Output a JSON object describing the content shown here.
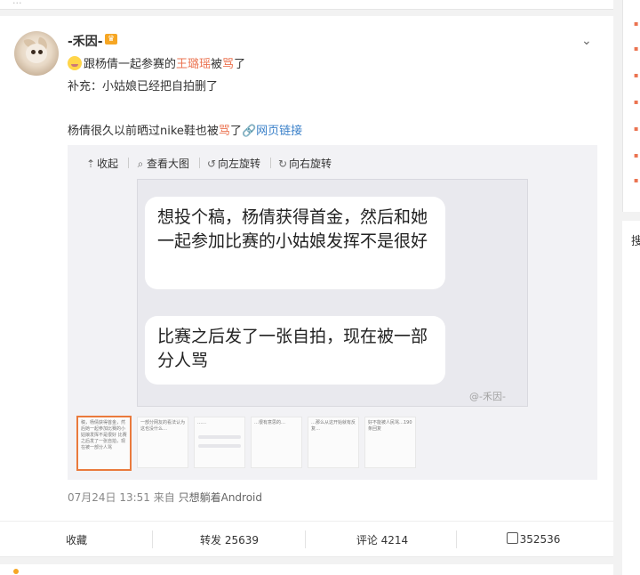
{
  "top_fragment": "...",
  "post": {
    "username": "-禾因-",
    "badge_icon": "crown-icon",
    "emoji_icon": "sleepy-face-emoji",
    "line1_prefix": "跟杨倩一起参赛的",
    "line1_highlight": "王璐瑶",
    "line1_middle": "被",
    "line1_link": "骂",
    "line1_suffix": "了",
    "line2": "补充：小姑娘已经把自拍删了",
    "line3_prefix": "杨倩很久以前晒过nike鞋也被",
    "line3_link": "骂",
    "line3_suffix": "了",
    "weblink": "网页链接"
  },
  "media_toolbar": {
    "collapse": "收起",
    "view_large": "查看大图",
    "rotate_left": "向左旋转",
    "rotate_right": "向右旋转"
  },
  "image_content": {
    "bubble1": "想投个稿，杨倩获得首金，然后和她一起参加比赛的小姑娘发挥不是很好",
    "bubble2": "比赛之后发了一张自拍，现在被一部分人骂",
    "watermark": "@-禾因-"
  },
  "thumbnails": [
    {
      "text": "稿，杨倩获得首金，然后她一起参加比赛的小姑娘发挥不是很好 比赛之后发了一张自拍，现在被一部分人骂",
      "selected": true
    },
    {
      "text": "一部分网友的看法认为这也没什么…",
      "selected": false
    },
    {
      "text": "……",
      "selected": false
    },
    {
      "text": "…很有意思的…",
      "selected": false
    },
    {
      "text": "…那么从这开始就有反复…",
      "selected": false
    },
    {
      "text": "好不能被人民骂…190条回复",
      "selected": false
    }
  ],
  "meta": {
    "date": "07月24日 13:51",
    "from_label": "来自",
    "source": "只想躺着Android"
  },
  "actions": {
    "favorite": "收藏",
    "repost": "转发 25639",
    "comment": "评论 4214",
    "like": "352536"
  },
  "right_panel": {
    "search_fragment": "搜"
  },
  "colors": {
    "link": "#eb7350",
    "weblink": "#3a80c9",
    "selected_thumb_border": "#ea7a3c"
  }
}
